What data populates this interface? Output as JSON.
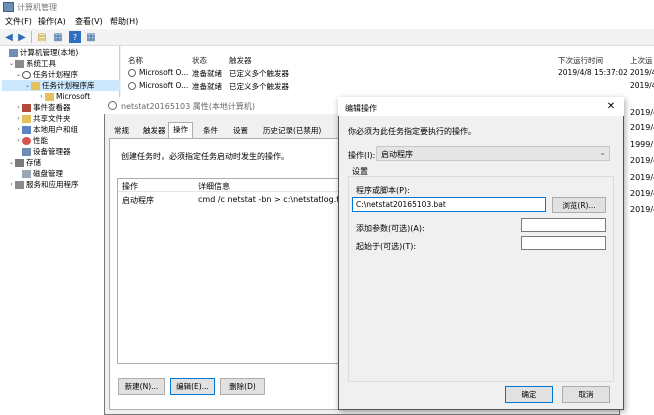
{
  "window": {
    "title": "计算机管理"
  },
  "menu": [
    "文件(F)",
    "操作(A)",
    "查看(V)",
    "帮助(H)"
  ],
  "tree": {
    "items": [
      {
        "label": "计算机管理(本地)",
        "level": 0
      },
      {
        "label": "系统工具",
        "level": 1
      },
      {
        "label": "任务计划程序",
        "level": 2
      },
      {
        "label": "任务计划程序库",
        "level": 3
      },
      {
        "label": "Microsoft",
        "level": 4
      },
      {
        "label": "事件查看器",
        "level": 2
      },
      {
        "label": "共享文件夹",
        "level": 2
      },
      {
        "label": "本地用户和组",
        "level": 2
      },
      {
        "label": "性能",
        "level": 2
      },
      {
        "label": "设备管理器",
        "level": 2
      },
      {
        "label": "存储",
        "level": 1
      },
      {
        "label": "磁盘管理",
        "level": 2
      },
      {
        "label": "服务和应用程序",
        "level": 1
      }
    ]
  },
  "list": {
    "headers": {
      "name": "名称",
      "status": "状态",
      "trigger": "触发器",
      "next_run": "下次运行时间",
      "last_run": "上次运"
    },
    "rows": [
      {
        "name": "Microsoft O...",
        "status": "准备就绪",
        "trigger": "已定义多个触发器",
        "next_run": "2019/4/8 15:37:02",
        "last_run": "2019/4"
      },
      {
        "name": "Microsoft O...",
        "status": "准备就绪",
        "trigger": "已定义多个触发器",
        "next_run": "",
        "last_run": "2019/4"
      }
    ],
    "right_col_values": [
      "2019/4",
      "2019/4",
      "1999/1",
      "2019/4",
      "2019/4",
      "2019/4",
      "2019/4"
    ]
  },
  "props": {
    "title": "netstat20165103 属性(本地计算机)",
    "tabs": [
      "常规",
      "触发器",
      "操作",
      "条件",
      "设置",
      "历史记录(已禁用)"
    ],
    "description": "创建任务时，必须指定任务启动时发生的操作。",
    "columns": {
      "action": "操作",
      "details": "详细信息"
    },
    "row": {
      "action": "启动程序",
      "details": "cmd /c netstat -bn > c:\\netstatlog.txt"
    },
    "buttons": {
      "new": "新建(N)...",
      "edit": "编辑(E)...",
      "delete": "删除(D)"
    }
  },
  "edit": {
    "title": "编辑操作",
    "instruction": "你必须为此任务指定要执行的操作。",
    "action_label": "操作(I):",
    "action_value": "启动程序",
    "settings": "设置",
    "program_label": "程序或脚本(P):",
    "program_value": "C:\\netstat20165103.bat",
    "browse": "浏览(R)...",
    "args_label": "添加参数(可选)(A):",
    "start_label": "起始于(可选)(T):",
    "ok": "确定",
    "cancel": "取消"
  }
}
